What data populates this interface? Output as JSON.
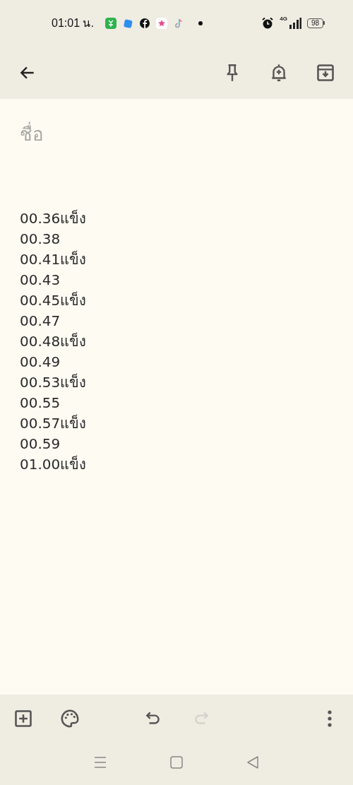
{
  "status_bar": {
    "time": "01:01 น.",
    "network": "4G",
    "battery": "98"
  },
  "note": {
    "title_placeholder": "ชื่อ",
    "lines": [
      "00.36แข็ง",
      "00.38",
      "00.41แข็ง",
      "00.43",
      "00.45แข็ง",
      "00.47",
      "00.48แข็ง",
      "00.49",
      "00.53แข็ง",
      "00.55",
      "00.57แข็ง",
      "00.59",
      "01.00แข็ง"
    ]
  },
  "bottom_bar": {
    "undo_disabled": false,
    "redo_disabled": true
  }
}
